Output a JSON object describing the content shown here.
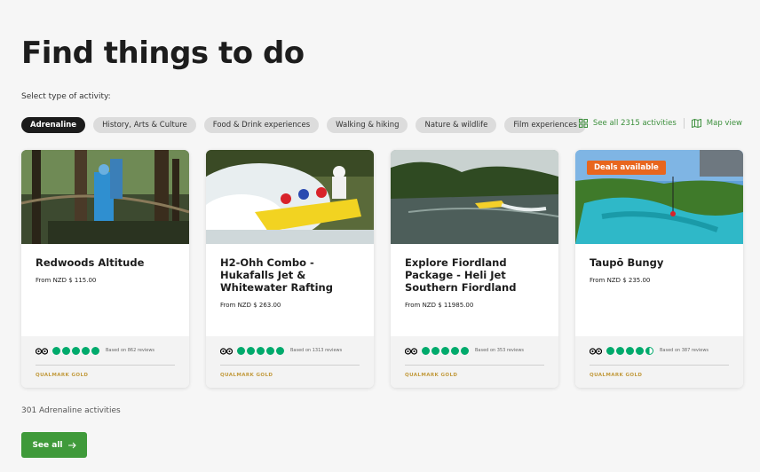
{
  "page_title": "Find things to do",
  "select_label": "Select type of activity:",
  "chips": [
    {
      "label": "Adrenaline",
      "active": true
    },
    {
      "label": "History, Arts & Culture",
      "active": false
    },
    {
      "label": "Food & Drink experiences",
      "active": false
    },
    {
      "label": "Walking & hiking",
      "active": false
    },
    {
      "label": "Nature & wildlife",
      "active": false
    },
    {
      "label": "Film experiences",
      "active": false
    }
  ],
  "links": {
    "see_all_activities": "See all 2315 activities",
    "map_view": "Map view"
  },
  "cards": [
    {
      "title": "Redwoods Altitude",
      "price": "From NZD $ 115.00",
      "rating": 5,
      "reviews": "Based on 862 reviews",
      "badge": "QUALMARK GOLD"
    },
    {
      "title": "H2-Ohh Combo - Hukafalls Jet & Whitewater Rafting",
      "price": "From NZD $ 263.00",
      "rating": 5,
      "reviews": "Based on 1313 reviews",
      "badge": "QUALMARK GOLD"
    },
    {
      "title": "Explore Fiordland Package - Heli Jet Southern Fiordland",
      "price": "From NZD $ 11985.00",
      "rating": 5,
      "reviews": "Based on 353 reviews",
      "badge": "QUALMARK GOLD"
    },
    {
      "title": "Taupō Bungy",
      "price": "From NZD $ 235.00",
      "rating": 4.5,
      "reviews": "Based on 387 reviews",
      "badge": "QUALMARK GOLD",
      "deal": "Deals available"
    }
  ],
  "activity_count": "301 Adrenaline activities",
  "see_all_button": "See all",
  "colors": {
    "accent_green": "#3f9a3a",
    "rating_green": "#00aa6c",
    "deal_orange": "#e8661e",
    "qualmark_gold": "#c29a3d"
  }
}
